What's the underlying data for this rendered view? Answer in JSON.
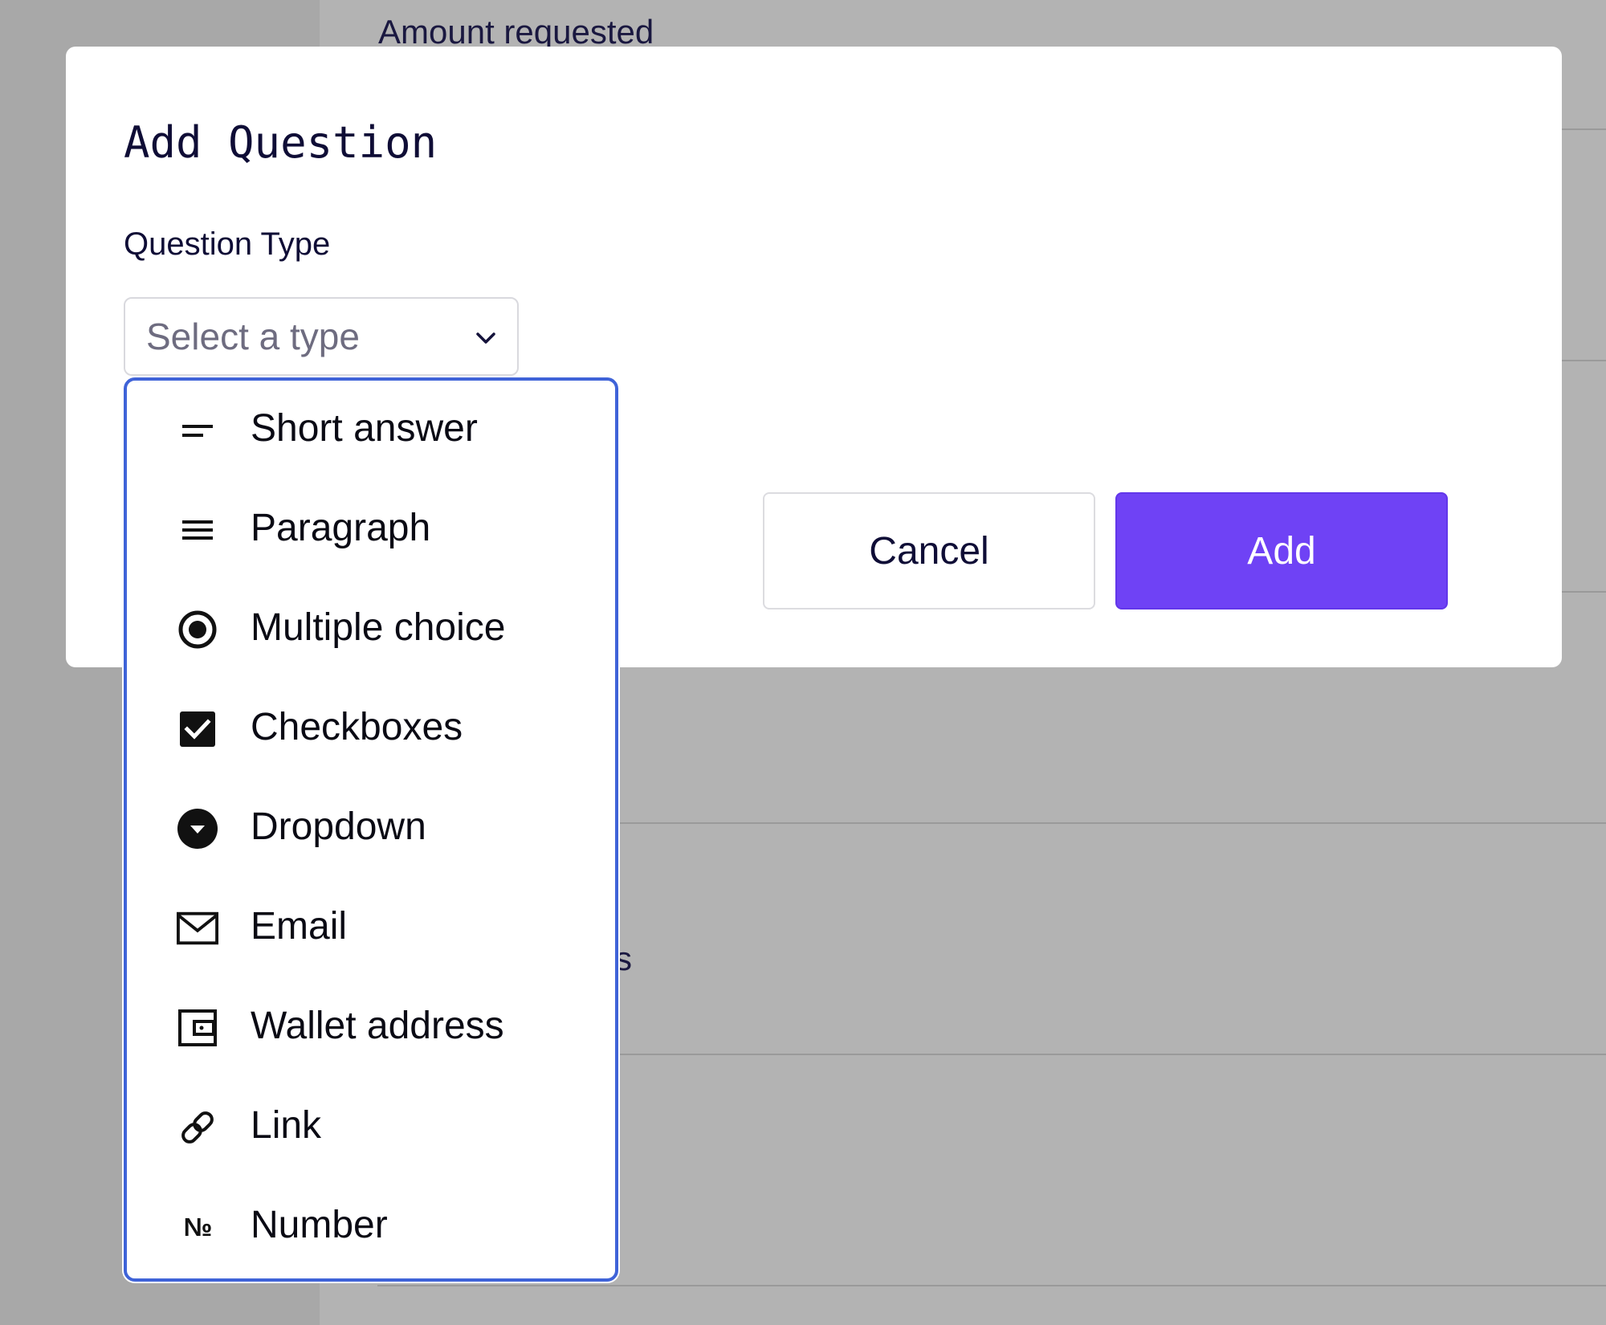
{
  "background": {
    "amount_label": "Amount requested",
    "fragment_text": "s"
  },
  "modal": {
    "title": "Add Question",
    "field_label": "Question Type",
    "select_placeholder": "Select a type",
    "cancel_label": "Cancel",
    "add_label": "Add"
  },
  "dropdown": {
    "items": [
      {
        "label": "Short answer",
        "icon": "short-answer-icon"
      },
      {
        "label": "Paragraph",
        "icon": "paragraph-icon"
      },
      {
        "label": "Multiple choice",
        "icon": "radio-icon"
      },
      {
        "label": "Checkboxes",
        "icon": "checkbox-icon"
      },
      {
        "label": "Dropdown",
        "icon": "dropdown-circle-icon"
      },
      {
        "label": "Email",
        "icon": "envelope-icon"
      },
      {
        "label": "Wallet address",
        "icon": "wallet-icon"
      },
      {
        "label": "Link",
        "icon": "link-icon"
      },
      {
        "label": "Number",
        "icon": "numero-icon",
        "icon_glyph": "№"
      }
    ]
  },
  "colors": {
    "accent": "#6f42f5",
    "dropdown_border": "#3f63d8",
    "text_dark": "#0f0d36",
    "overlay": "#b3b3b3"
  }
}
